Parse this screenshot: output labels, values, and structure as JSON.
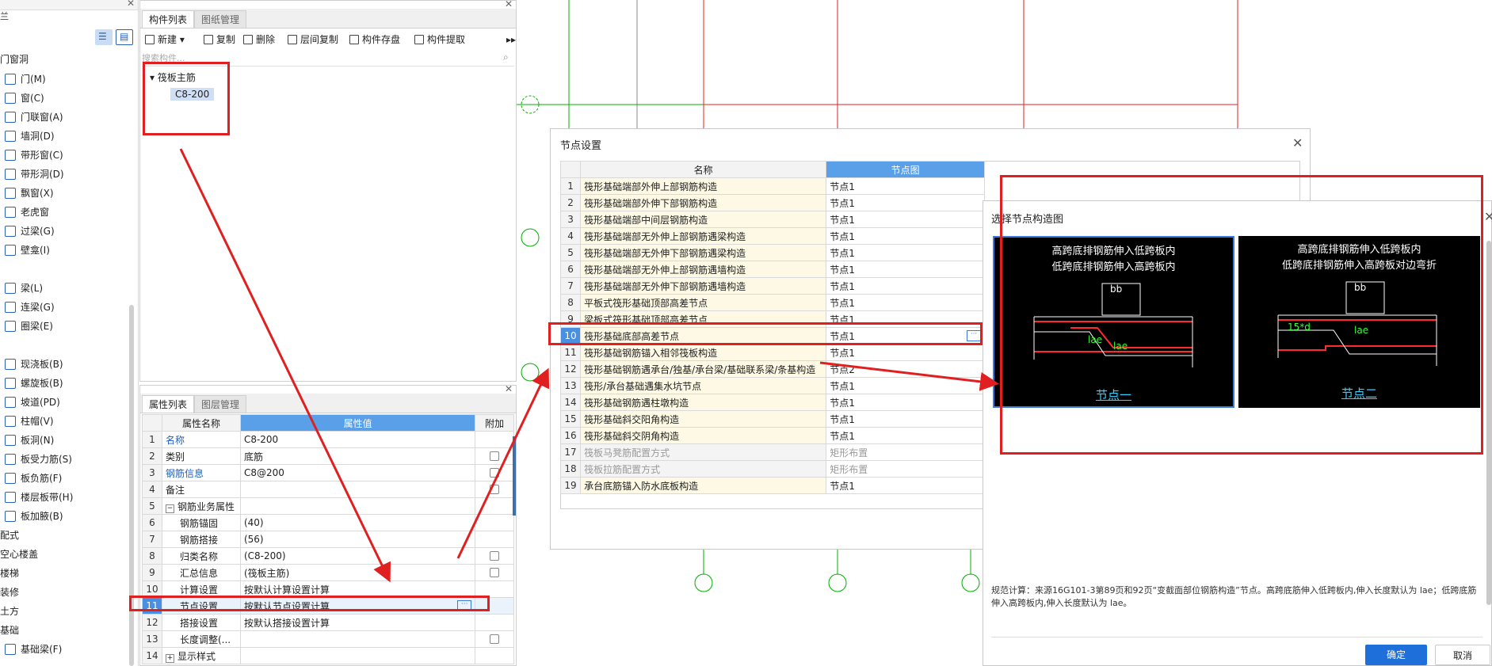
{
  "left_panel": {
    "section_top": "门窗洞",
    "items": [
      {
        "label": "门(M)",
        "icon": "door-icon"
      },
      {
        "label": "窗(C)",
        "icon": "window-icon"
      },
      {
        "label": "门联窗(A)",
        "icon": "door-window-icon"
      },
      {
        "label": "墙洞(D)",
        "icon": "wall-hole-icon"
      },
      {
        "label": "带形窗(C)",
        "icon": "strip-window-icon"
      },
      {
        "label": "带形洞(D)",
        "icon": "strip-hole-icon"
      },
      {
        "label": "飘窗(X)",
        "icon": "bay-window-icon"
      },
      {
        "label": "老虎窗",
        "icon": "dormer-icon"
      },
      {
        "label": "过梁(G)",
        "icon": "lintel-icon"
      },
      {
        "label": "壁龛(I)",
        "icon": "niche-icon"
      },
      {
        "label": "梁(L)",
        "icon": "beam-icon"
      },
      {
        "label": "连梁(G)",
        "icon": "coupling-beam-icon"
      },
      {
        "label": "圈梁(E)",
        "icon": "ring-beam-icon"
      },
      {
        "label": "现浇板(B)",
        "icon": "slab-icon"
      },
      {
        "label": "螺旋板(B)",
        "icon": "spiral-slab-icon"
      },
      {
        "label": "坡道(PD)",
        "icon": "ramp-icon"
      },
      {
        "label": "柱帽(V)",
        "icon": "column-cap-icon"
      },
      {
        "label": "板洞(N)",
        "icon": "slab-hole-icon"
      },
      {
        "label": "板受力筋(S)",
        "icon": "slab-rebar-icon"
      },
      {
        "label": "板负筋(F)",
        "icon": "slab-neg-rebar-icon"
      },
      {
        "label": "楼层板带(H)",
        "icon": "floor-strip-icon"
      },
      {
        "label": "板加腋(B)",
        "icon": "slab-haunch-icon"
      }
    ],
    "bottom_items": [
      "配式",
      "空心楼盖",
      "楼梯",
      "装修",
      "土方",
      "基础"
    ],
    "last_item": {
      "label": "基础梁(F)",
      "icon": "foundation-beam-icon"
    }
  },
  "comp_panel": {
    "tabs": [
      "构件列表",
      "图纸管理"
    ],
    "toolbar": [
      "新建",
      "复制",
      "删除",
      "层间复制",
      "构件存盘",
      "构件提取"
    ],
    "search_placeholder": "搜索构件...",
    "tree_root": "筏板主筋",
    "tree_child": "C8-200"
  },
  "prop_panel": {
    "tabs": [
      "属性列表",
      "图层管理"
    ],
    "headers": [
      "属性名称",
      "属性值",
      "附加"
    ],
    "rows": [
      {
        "n": "1",
        "name": "名称",
        "value": "C8-200",
        "check": false,
        "blue": true
      },
      {
        "n": "2",
        "name": "类别",
        "value": "底筋",
        "check": true,
        "blue": false
      },
      {
        "n": "3",
        "name": "钢筋信息",
        "value": "C8@200",
        "check": true,
        "blue": true
      },
      {
        "n": "4",
        "name": "备注",
        "value": "",
        "check": true,
        "blue": false
      },
      {
        "n": "5",
        "name": "钢筋业务属性",
        "value": "",
        "check": false,
        "blue": false
      },
      {
        "n": "6",
        "name": "钢筋锚固",
        "value": "(40)",
        "check": false,
        "blue": false
      },
      {
        "n": "7",
        "name": "钢筋搭接",
        "value": "(56)",
        "check": false,
        "blue": false
      },
      {
        "n": "8",
        "name": "归类名称",
        "value": "(C8-200)",
        "check": true,
        "blue": false
      },
      {
        "n": "9",
        "name": "汇总信息",
        "value": "(筏板主筋)",
        "check": true,
        "blue": false
      },
      {
        "n": "10",
        "name": "计算设置",
        "value": "按默认计算设置计算",
        "check": false,
        "blue": false
      },
      {
        "n": "11",
        "name": "节点设置",
        "value": "按默认节点设置计算",
        "check": false,
        "blue": false
      },
      {
        "n": "12",
        "name": "搭接设置",
        "value": "按默认搭接设置计算",
        "check": false,
        "blue": false
      },
      {
        "n": "13",
        "name": "长度调整(...",
        "value": "",
        "check": true,
        "blue": false
      },
      {
        "n": "14",
        "name": "显示样式",
        "value": "",
        "check": false,
        "blue": false
      }
    ]
  },
  "node_dialog": {
    "title": "节点设置",
    "headers": [
      "名称",
      "节点图"
    ],
    "rows": [
      {
        "n": "1",
        "name": "筏形基础端部外伸上部钢筋构造",
        "node": "节点1",
        "gray": false
      },
      {
        "n": "2",
        "name": "筏形基础端部外伸下部钢筋构造",
        "node": "节点1",
        "gray": false
      },
      {
        "n": "3",
        "name": "筏形基础端部中间层钢筋构造",
        "node": "节点1",
        "gray": false
      },
      {
        "n": "4",
        "name": "筏形基础端部无外伸上部钢筋遇梁构造",
        "node": "节点1",
        "gray": false
      },
      {
        "n": "5",
        "name": "筏形基础端部无外伸下部钢筋遇梁构造",
        "node": "节点1",
        "gray": false
      },
      {
        "n": "6",
        "name": "筏形基础端部无外伸上部钢筋遇墙构造",
        "node": "节点1",
        "gray": false
      },
      {
        "n": "7",
        "name": "筏形基础端部无外伸下部钢筋遇墙构造",
        "node": "节点1",
        "gray": false
      },
      {
        "n": "8",
        "name": "平板式筏形基础顶部高差节点",
        "node": "节点1",
        "gray": false
      },
      {
        "n": "9",
        "name": "梁板式筏形基础顶部高差节点",
        "node": "节点1",
        "gray": false
      },
      {
        "n": "10",
        "name": "筏形基础底部高差节点",
        "node": "节点1",
        "gray": false
      },
      {
        "n": "11",
        "name": "筏形基础钢筋锚入相邻筏板构造",
        "node": "节点1",
        "gray": false
      },
      {
        "n": "12",
        "name": "筏形基础钢筋遇承台/独基/承台梁/基础联系梁/条基构造",
        "node": "节点2",
        "gray": false
      },
      {
        "n": "13",
        "name": "筏形/承台基础遇集水坑节点",
        "node": "节点1",
        "gray": false
      },
      {
        "n": "14",
        "name": "筏形基础钢筋遇柱墩构造",
        "node": "节点1",
        "gray": false
      },
      {
        "n": "15",
        "name": "筏形基础斜交阳角构造",
        "node": "节点1",
        "gray": false
      },
      {
        "n": "16",
        "name": "筏形基础斜交阴角构造",
        "node": "节点1",
        "gray": false
      },
      {
        "n": "17",
        "name": "筏板马凳筋配置方式",
        "node": "矩形布置",
        "gray": true
      },
      {
        "n": "18",
        "name": "筏板拉筋配置方式",
        "node": "矩形布置",
        "gray": true
      },
      {
        "n": "19",
        "name": "承台底筋锚入防水底板构造",
        "node": "节点1",
        "gray": false
      }
    ]
  },
  "select_dialog": {
    "title": "选择节点构造图",
    "card1": {
      "line1": "高跨底排钢筋伸入低跨板内",
      "line2": "低跨底排钢筋伸入高跨板内",
      "bb": "bb",
      "lae1": "lae",
      "lae2": "lae",
      "caption": "节点一"
    },
    "card2": {
      "line1": "高跨底排钢筋伸入低跨板内",
      "line2": "低跨底排钢筋伸入高跨板对边弯折",
      "bb": "bb",
      "d15": "15*d",
      "lae": "lae",
      "caption": "节点二"
    },
    "description": "规范计算：来源16G101-3第89页和92页“变截面部位钢筋构造”节点。高跨底筋伸入低跨板内,伸入长度默认为 lae；低跨底筋伸入高跨板内,伸入长度默认为 lae。",
    "ok": "确定",
    "cancel": "取消"
  },
  "colors": {
    "accent": "#1e6fd9",
    "highlight": "#e02020",
    "selected_header": "#5aa0e8"
  }
}
